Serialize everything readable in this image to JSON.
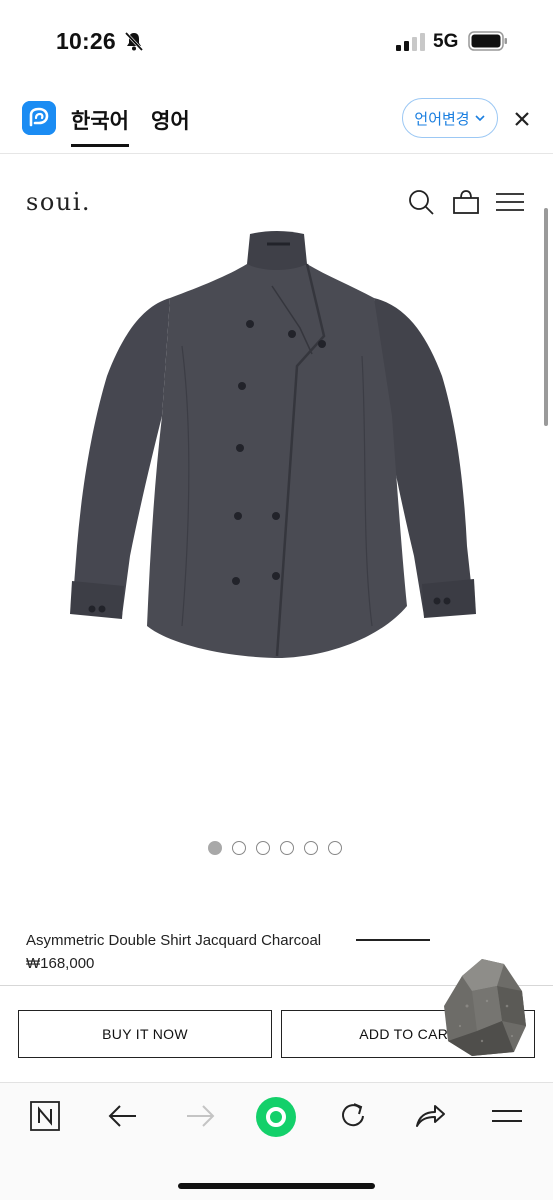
{
  "status_bar": {
    "time": "10:26",
    "network": "5G"
  },
  "translate_bar": {
    "lang_source": "한국어",
    "lang_target": "영어",
    "change_language_label": "언어변경",
    "accent_color": "#1b8cf3"
  },
  "site": {
    "brand": "soui."
  },
  "product": {
    "name": "Asymmetric Double Shirt Jacquard Charcoal",
    "price": "₩168,000",
    "image_count": 6,
    "active_image_index": 0,
    "shirt_color": "#4a4b50"
  },
  "actions": {
    "buy_now_label": "BUY IT NOW",
    "add_to_cart_label": "ADD TO CART"
  },
  "browser_bar": {
    "icons": [
      "naver-icon",
      "back-arrow-icon",
      "forward-arrow-icon",
      "green-home-icon",
      "reload-icon",
      "share-icon",
      "menu-icon"
    ]
  }
}
